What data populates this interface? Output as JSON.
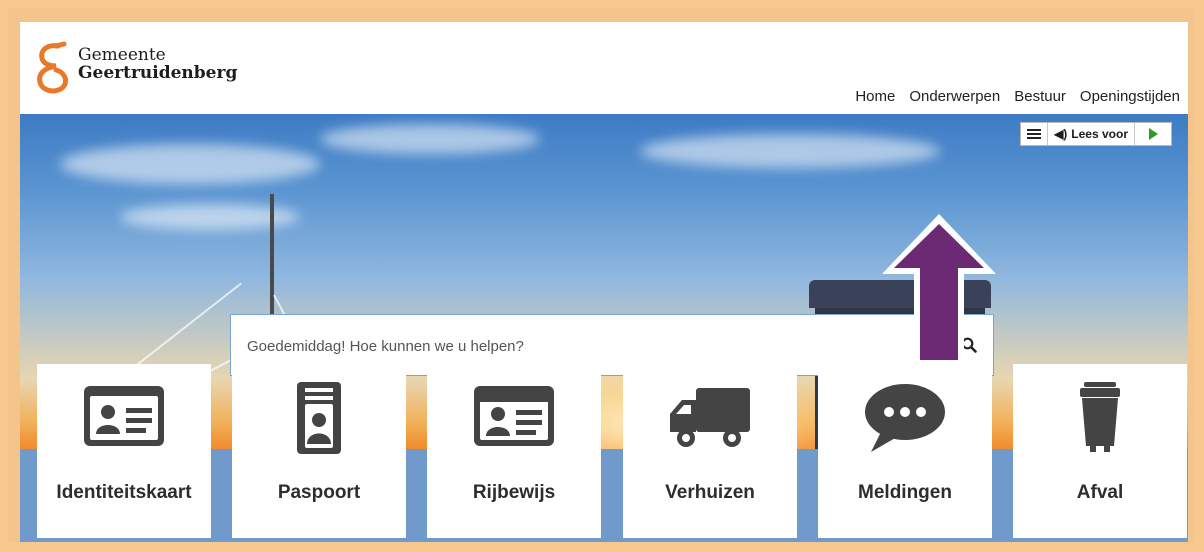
{
  "brand": {
    "line1": "Gemeente",
    "line2": "Geertruidenberg"
  },
  "nav": [
    "Home",
    "Onderwerpen",
    "Bestuur",
    "Openingstijden"
  ],
  "readbar": {
    "read_label": "Lees voor"
  },
  "search": {
    "placeholder": "Goedemiddag! Hoe kunnen we u helpen?"
  },
  "tiles": [
    {
      "label": "Identiteitskaart",
      "icon": "id-card-icon"
    },
    {
      "label": "Paspoort",
      "icon": "passport-icon"
    },
    {
      "label": "Rijbewijs",
      "icon": "drivers-license-icon"
    },
    {
      "label": "Verhuizen",
      "icon": "truck-icon"
    },
    {
      "label": "Meldingen",
      "icon": "speech-bubble-icon"
    },
    {
      "label": "Afval",
      "icon": "trash-bin-icon"
    }
  ],
  "colors": {
    "logo": "#e8792b",
    "arrow": "#6b2a73",
    "icons": "#444444",
    "frame": "#f3c58c"
  }
}
